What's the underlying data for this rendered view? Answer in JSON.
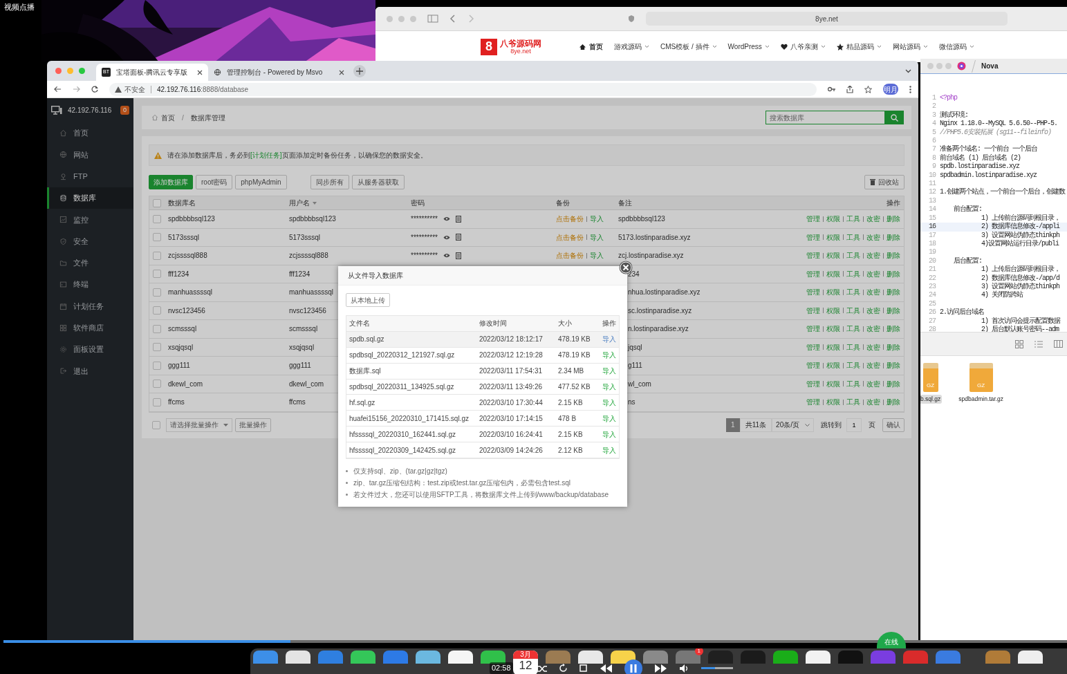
{
  "video": {
    "title": "视频点播",
    "progress": {
      "level": 0.27
    },
    "time": "02:58",
    "volume": {
      "level": 0.45
    },
    "online_button": "在线"
  },
  "safari": {
    "address": "8ye.net",
    "logo": {
      "mark": "8",
      "name": "八爷源码网",
      "domain": "8ye.net"
    },
    "nav": [
      {
        "label": "首页",
        "caret": false
      },
      {
        "label": "游戏源码",
        "caret": true
      },
      {
        "label": "CMS模板 / 插件",
        "caret": true
      },
      {
        "label": "WordPress",
        "caret": true
      },
      {
        "label": "八爷亲测",
        "caret": true
      },
      {
        "label": "精品源码",
        "caret": true
      },
      {
        "label": "网站源码",
        "caret": true
      },
      {
        "label": "微信源码",
        "caret": true
      }
    ]
  },
  "chrome": {
    "tabs": [
      {
        "title": "宝塔面板-腾讯云专享版",
        "favicon": "BT",
        "selected": true
      },
      {
        "title": "管理控制台 - Powered by Msvo",
        "selected": false
      }
    ],
    "security": "不安全",
    "url_host": "42.192.76.116",
    "url_path": ":8888/database",
    "avatar": "明月"
  },
  "panel": {
    "server": "42.192.76.116",
    "badge": "0",
    "menu": [
      {
        "label": "首页",
        "selected": false
      },
      {
        "label": "网站",
        "selected": false
      },
      {
        "label": "FTP",
        "selected": false
      },
      {
        "label": "数据库",
        "selected": true
      },
      {
        "label": "监控",
        "selected": false
      },
      {
        "label": "安全",
        "selected": false
      },
      {
        "label": "文件",
        "selected": false
      },
      {
        "label": "终端",
        "selected": false
      },
      {
        "label": "计划任务",
        "selected": false
      },
      {
        "label": "软件商店",
        "selected": false
      },
      {
        "label": "面板设置",
        "selected": false
      },
      {
        "label": "退出",
        "selected": false
      }
    ],
    "breadcrumb": {
      "items": [
        "首页",
        "数据库管理"
      ],
      "separator": "/"
    },
    "search": {
      "placeholder": "搜索数据库"
    },
    "alert": {
      "before": "请在添加数据库后，务必到",
      "link": "[计划任务]",
      "after": "页面添加定时备份任务，以确保您的数据安全。"
    },
    "buttons": [
      {
        "label": "添加数据库",
        "kind": "primary"
      },
      {
        "label": "root密码",
        "kind": "default"
      },
      {
        "label": "phpMyAdmin",
        "kind": "default"
      },
      {
        "label": "同步所有",
        "kind": "spaced"
      },
      {
        "label": "从服务器获取",
        "kind": "default"
      }
    ],
    "recycle": "回收站",
    "table": {
      "all_checked": false,
      "columns": [
        {
          "label": "数据库名",
          "sort": false
        },
        {
          "label": "用户名",
          "sort": true
        },
        {
          "label": "密码",
          "sort": false
        },
        {
          "label": "备份",
          "sort": false
        },
        {
          "label": "备注",
          "sort": false
        },
        {
          "label": "操作",
          "sort": false
        }
      ],
      "rows": [
        {
          "checked": false,
          "name": "spdbbbbsql123",
          "user": "spdbbbbsql123",
          "password": "**********",
          "backup": "点击备份",
          "import": "导入",
          "remark": "spdbbbbsql123",
          "covered": false,
          "ops": [
            "管理",
            "权限",
            "工具",
            "改密",
            "删除"
          ]
        },
        {
          "checked": false,
          "name": "5173sssql",
          "user": "5173sssql",
          "password": "**********",
          "backup": "点击备份",
          "import": "导入",
          "remark": "5173.lostinparadise.xyz",
          "covered": false,
          "ops": [
            "管理",
            "权限",
            "工具",
            "改密",
            "删除"
          ]
        },
        {
          "checked": false,
          "name": "zcjssssql888",
          "user": "zcjssssql888",
          "password": "**********",
          "backup": "点击备份",
          "import": "导入",
          "remark": "zcj.lostinparadise.xyz",
          "covered": false,
          "ops": [
            "管理",
            "权限",
            "工具",
            "改密",
            "删除"
          ]
        },
        {
          "checked": false,
          "name": "fff1234",
          "user": "fff1234",
          "remark": "234",
          "covered": true,
          "ops": [
            "管理",
            "权限",
            "工具",
            "改密",
            "删除"
          ]
        },
        {
          "checked": false,
          "name": "manhuassssql",
          "user": "manhuassssql",
          "remark": "nhua.lostinparadise.xyz",
          "covered": true,
          "ops": [
            "管理",
            "权限",
            "工具",
            "改密",
            "删除"
          ]
        },
        {
          "checked": false,
          "name": "nvsc123456",
          "user": "nvsc123456",
          "remark": "sc.lostinparadise.xyz",
          "covered": true,
          "ops": [
            "管理",
            "权限",
            "工具",
            "改密",
            "删除"
          ]
        },
        {
          "checked": false,
          "name": "scmsssql",
          "user": "scmsssql",
          "remark": "n.lostinparadise.xyz",
          "covered": true,
          "ops": [
            "管理",
            "权限",
            "工具",
            "改密",
            "删除"
          ]
        },
        {
          "checked": false,
          "name": "xsqjqsql",
          "user": "xsqjqsql",
          "remark": "jqsql",
          "covered": true,
          "ops": [
            "管理",
            "权限",
            "工具",
            "改密",
            "删除"
          ]
        },
        {
          "checked": false,
          "name": "ggg111",
          "user": "ggg111",
          "remark": "g111",
          "covered": true,
          "ops": [
            "管理",
            "权限",
            "工具",
            "改密",
            "删除"
          ]
        },
        {
          "checked": false,
          "name": "dkewl_com",
          "user": "dkewl_com",
          "remark": "wl_com",
          "covered": true,
          "ops": [
            "管理",
            "权限",
            "工具",
            "改密",
            "删除"
          ]
        },
        {
          "checked": false,
          "name": "ffcms",
          "user": "ffcms",
          "remark": "ns",
          "covered": true,
          "ops": [
            "管理",
            "权限",
            "工具",
            "改密",
            "删除"
          ]
        }
      ]
    },
    "batch": {
      "checked": false,
      "placeholder": "请选择批量操作",
      "button": "批量操作"
    },
    "pagination": {
      "current": "1",
      "total": "共11条",
      "per_page": "20条/页",
      "jump_label": "跳转到",
      "jump_value": "1",
      "page_unit": "页",
      "confirm": "确认"
    }
  },
  "modal": {
    "title": "从文件导入数据库",
    "upload": "从本地上传",
    "columns": [
      "文件名",
      "修改时间",
      "大小",
      "操作"
    ],
    "files": [
      {
        "name": "spdb.sql.gz",
        "time": "2022/03/12 18:12:17",
        "size": "478.19 KB",
        "action": "导入",
        "hovered": true
      },
      {
        "name": "spdbsql_20220312_121927.sql.gz",
        "time": "2022/03/12 12:19:28",
        "size": "478.19 KB",
        "action": "导入",
        "hovered": false
      },
      {
        "name": "数据库.sql",
        "time": "2022/03/11 17:54:31",
        "size": "2.34 MB",
        "action": "导入",
        "hovered": false
      },
      {
        "name": "spdbsql_20220311_134925.sql.gz",
        "time": "2022/03/11 13:49:26",
        "size": "477.52 KB",
        "action": "导入",
        "hovered": false
      },
      {
        "name": "hf.sql.gz",
        "time": "2022/03/10 17:30:44",
        "size": "2.15 KB",
        "action": "导入",
        "hovered": false
      },
      {
        "name": "huafei15156_20220310_171415.sql.gz",
        "time": "2022/03/10 17:14:15",
        "size": "478 B",
        "action": "导入",
        "hovered": false
      },
      {
        "name": "hfssssql_20220310_162441.sql.gz",
        "time": "2022/03/10 16:24:41",
        "size": "2.15 KB",
        "action": "导入",
        "hovered": false
      },
      {
        "name": "hfssssql_20220309_142425.sql.gz",
        "time": "2022/03/09 14:24:26",
        "size": "2.12 KB",
        "action": "导入",
        "hovered": false
      }
    ],
    "notes": [
      "仅支持sql、zip、(tar.gz|gz|tgz)",
      "zip、tar.gz压缩包结构：test.zip或test.tar.gz压缩包内，必需包含test.sql",
      "若文件过大，您还可以使用SFTP工具，将数据库文件上传到/www/backup/database"
    ]
  },
  "editor": {
    "tab": "Nova",
    "lines": [
      {
        "n": "1",
        "text": "<?php",
        "kind": "tag",
        "current": false
      },
      {
        "n": "2",
        "current": false
      },
      {
        "n": "3",
        "text": "测试环境:",
        "kind": "plain",
        "current": false
      },
      {
        "n": "4",
        "text": "Nginx 1.18.0--MySQL 5.6.50--PHP-5.",
        "kind": "plain",
        "current": false
      },
      {
        "n": "5",
        "text": "//PHP5.6安装拓展 (sg11--fileinfo)",
        "kind": "comment",
        "current": false
      },
      {
        "n": "6",
        "current": false
      },
      {
        "n": "7",
        "text": "准备两个域名: 一个前台 一个后台",
        "kind": "plain",
        "current": false
      },
      {
        "n": "8",
        "text": "前台域名 (1) 后台域名 (2)",
        "kind": "plain",
        "current": false
      },
      {
        "n": "9",
        "text": "spdb.lostinparadise.xyz",
        "kind": "plain",
        "current": false
      },
      {
        "n": "10",
        "text": "spdbadmin.lostinparadise.xyz",
        "kind": "plain",
        "current": false
      },
      {
        "n": "11",
        "current": false
      },
      {
        "n": "12",
        "text": "1.创建两个站点，一个前台一个后台，创建数",
        "kind": "plain",
        "current": false
      },
      {
        "n": "13",
        "current": false
      },
      {
        "n": "14",
        "text": "    前台配置:",
        "kind": "plain",
        "current": false
      },
      {
        "n": "15",
        "text": "            1) 上传前台源码到根目录，",
        "kind": "plain",
        "current": false
      },
      {
        "n": "16",
        "text": "            2) 数据库信息修改-/appli",
        "kind": "plain",
        "current": true
      },
      {
        "n": "17",
        "text": "            3) 设置网站伪静态thinkph",
        "kind": "plain",
        "current": false
      },
      {
        "n": "18",
        "text": "            4)设置网站运行目录/publi",
        "kind": "plain",
        "current": false
      },
      {
        "n": "19",
        "current": false
      },
      {
        "n": "20",
        "text": "    后台配置:",
        "kind": "plain",
        "current": false
      },
      {
        "n": "21",
        "text": "            1) 上传后台源码到根目录，",
        "kind": "plain",
        "current": false
      },
      {
        "n": "22",
        "text": "            2) 数据库信息修改-/app/d",
        "kind": "plain",
        "current": false
      },
      {
        "n": "23",
        "text": "            3) 设置网站伪静态thinkph",
        "kind": "plain",
        "current": false
      },
      {
        "n": "24",
        "text": "            4) 关闭防跨站",
        "kind": "plain",
        "current": false
      },
      {
        "n": "25",
        "current": false
      },
      {
        "n": "26",
        "text": "2.访问后台域名",
        "kind": "plain",
        "current": false
      },
      {
        "n": "27",
        "text": "            1) 首次访问会提示配置数据",
        "kind": "plain",
        "current": false
      },
      {
        "n": "28",
        "text": "            2) 后台默认账号密码--adm",
        "kind": "plain",
        "current": false
      }
    ]
  },
  "finder": {
    "files": [
      {
        "name": "b.sql.gz",
        "badge": "GZ",
        "selected": true
      },
      {
        "name": "spdbadmin.tar.gz",
        "badge": "GZ",
        "selected": false
      }
    ]
  },
  "dock": {
    "calendar_month": "3月",
    "calendar_day": "12",
    "badge": "1"
  }
}
